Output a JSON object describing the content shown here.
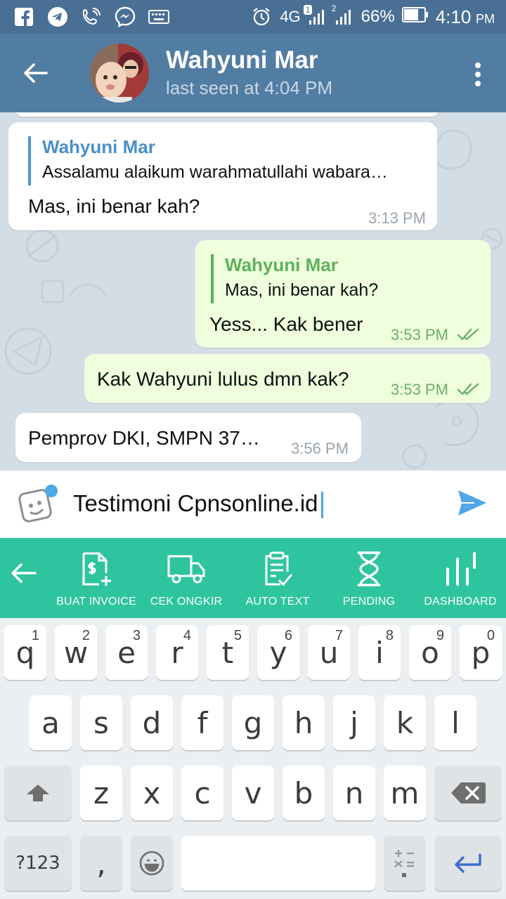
{
  "status_bar": {
    "network": "4G",
    "sim1_badge": "1",
    "sim2_badge": "2",
    "battery": "66%",
    "time": "4:10",
    "ampm": "PM",
    "left_icons": [
      "facebook-icon",
      "telegram-icon",
      "phone-wifi-icon",
      "messenger-icon",
      "keyboard-icon"
    ],
    "right_icons": [
      "alarm-icon",
      "signal-icon",
      "battery-icon"
    ]
  },
  "header": {
    "name": "Wahyuni Mar",
    "last_seen": "last seen at 4:04 PM"
  },
  "messages": [
    {
      "direction": "in",
      "reply_name": "Wahyuni Mar",
      "reply_text": "Assalamu alaikum warahmatullahi wabara…",
      "text": "Mas, ini benar kah?",
      "time": "3:13 PM"
    },
    {
      "direction": "out",
      "reply_name": "Wahyuni Mar",
      "reply_text": "Mas, ini benar kah?",
      "text": "Yess... Kak bener",
      "time": "3:53 PM",
      "read": true
    },
    {
      "direction": "out",
      "text": "Kak Wahyuni lulus dmn kak?",
      "time": "3:53 PM",
      "read": true
    },
    {
      "direction": "in",
      "text": "Pemprov DKI, SMPN 37…",
      "time": "3:56 PM"
    }
  ],
  "input": {
    "value": "Testimoni Cpnsonline.id"
  },
  "toolbar": {
    "items": [
      {
        "label": "BUAT INVOICE",
        "icon": "invoice-icon"
      },
      {
        "label": "CEK ONGKIR",
        "icon": "truck-icon"
      },
      {
        "label": "AUTO TEXT",
        "icon": "clipboard-check-icon"
      },
      {
        "label": "PENDING",
        "icon": "hourglass-icon"
      },
      {
        "label": "DASHBOARD",
        "icon": "bars-icon"
      }
    ]
  },
  "keyboard": {
    "row1": [
      {
        "k": "q",
        "h": "1"
      },
      {
        "k": "w",
        "h": "2"
      },
      {
        "k": "e",
        "h": "3"
      },
      {
        "k": "r",
        "h": "4"
      },
      {
        "k": "t",
        "h": "5"
      },
      {
        "k": "y",
        "h": "6"
      },
      {
        "k": "u",
        "h": "7"
      },
      {
        "k": "i",
        "h": "8"
      },
      {
        "k": "o",
        "h": "9"
      },
      {
        "k": "p",
        "h": "0"
      }
    ],
    "row2": [
      "a",
      "s",
      "d",
      "f",
      "g",
      "h",
      "j",
      "k",
      "l"
    ],
    "row3": [
      "z",
      "x",
      "c",
      "v",
      "b",
      "n",
      "m"
    ],
    "symbols": "?123",
    "comma": ",",
    "colors": {
      "accent": "#2ec4a0",
      "header": "#527da3",
      "send": "#4fa7e5"
    }
  }
}
